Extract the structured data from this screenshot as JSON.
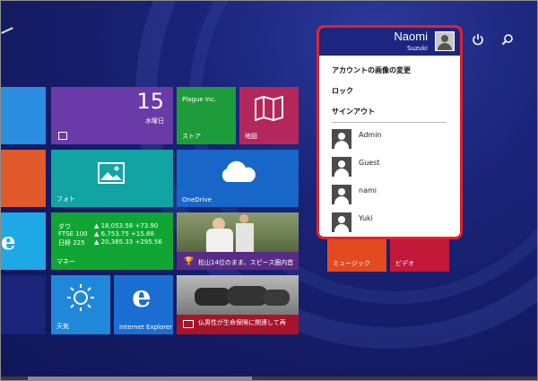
{
  "clock": {
    "date": "15",
    "weekday": "水曜日"
  },
  "tiles": {
    "game": "Plague Inc.",
    "store": "ストア",
    "maps": "地図",
    "photos": "フォト",
    "onedrive": "OneDrive",
    "money": {
      "label": "マネー",
      "rows": [
        {
          "name": "ダウ",
          "value": "▲ 18,053.58 +73.90"
        },
        {
          "name": "FTSE 100",
          "value": "▲ 6,753.75 +15.88"
        },
        {
          "name": "日経 225",
          "value": "▲ 20,385.33 +295.56"
        }
      ]
    },
    "sports_headline": "松山14位のまま、スピース圏内首",
    "weather": "天気",
    "ie": "Internet Explorer",
    "news_headline": "仏男性が生命保険に関連して再",
    "music": "ミュージック",
    "video": "ビデオ"
  },
  "user_menu": {
    "first_name": "Naomi",
    "last_name": "Suzuki",
    "items": [
      "アカウントの画像の変更",
      "ロック",
      "サインアウト"
    ],
    "users": [
      "Admin",
      "Guest",
      "nami",
      "Yuki"
    ]
  },
  "colors": {
    "accent_highlight": "#e0232a",
    "background": "#141b62"
  },
  "icons": [
    "power-icon",
    "search-icon"
  ]
}
